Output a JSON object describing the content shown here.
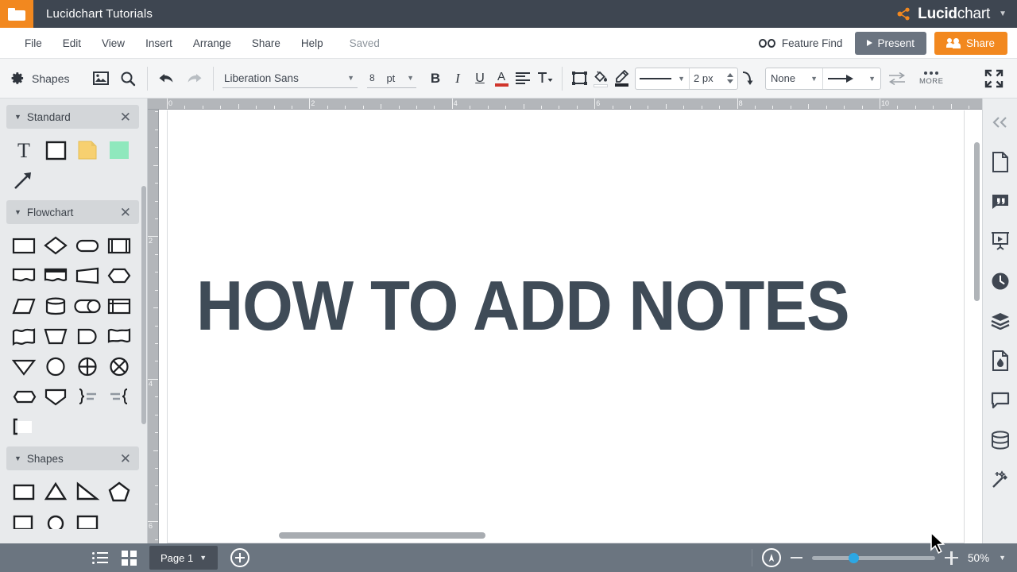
{
  "titlebar": {
    "folder_icon": "folder-icon",
    "document_title": "Lucidchart Tutorials",
    "brand_bold": "Lucid",
    "brand_light": "chart",
    "brand_caret": "▼"
  },
  "menubar": {
    "items": [
      {
        "label": "File"
      },
      {
        "label": "Edit"
      },
      {
        "label": "View"
      },
      {
        "label": "Insert"
      },
      {
        "label": "Arrange"
      },
      {
        "label": "Share"
      },
      {
        "label": "Help"
      }
    ],
    "save_status": "Saved",
    "feature_find": "Feature Find",
    "present_label": "Present",
    "share_label": "Share"
  },
  "toolbar": {
    "shapes_label": "Shapes",
    "image_icon": "image-icon",
    "search_icon": "search-icon",
    "undo_icon": "undo-icon",
    "redo_icon": "redo-icon",
    "font_family": "Liberation Sans",
    "font_size": "8",
    "font_unit": "pt",
    "bold": "B",
    "italic": "I",
    "underline": "U",
    "text_color_letter": "A",
    "text_color": "#d0352b",
    "align_icon": "align-left-icon",
    "text_options_icon": "text-options-icon",
    "shape_border_icon": "shape-border-icon",
    "fill_icon": "fill-bucket-icon",
    "line_color_icon": "line-color-icon",
    "line_style": "solid",
    "line_width": "2 px",
    "curve_icon": "line-curve-icon",
    "arrow_start": "None",
    "arrow_end_icon": "arrow-end-icon",
    "swap_icon": "swap-arrows-icon",
    "more_label": "MORE",
    "fullscreen_icon": "fullscreen-icon",
    "caret": "▼"
  },
  "shape_panel": {
    "sections": [
      {
        "name": "Standard",
        "collapse_icon": "▼",
        "close_icon": "✕",
        "shapes": [
          "text-tool",
          "rectangle",
          "sticky-note",
          "green-block",
          "arrow-tool"
        ]
      },
      {
        "name": "Flowchart",
        "collapse_icon": "▼",
        "close_icon": "✕",
        "shapes": [
          "process",
          "decision",
          "terminator",
          "predefined-process",
          "document",
          "multi-document",
          "trapezoid-data",
          "preparation",
          "parallelogram-data",
          "database-cylinder",
          "direct-access-storage",
          "internal-storage",
          "wave-document",
          "manual-operation",
          "display",
          "delay",
          "merge-triangle",
          "connector-circle",
          "summing-junction",
          "or-junction",
          "stored-data",
          "manual-input",
          "brace-right",
          "brace-left",
          "bracket-card"
        ]
      },
      {
        "name": "Shapes",
        "collapse_icon": "▼",
        "close_icon": "✕",
        "shapes": [
          "square",
          "triangle",
          "right-triangle",
          "pentagon"
        ]
      }
    ]
  },
  "canvas": {
    "title_text": "HOW TO ADD NOTES",
    "title_color": "#3f4b57",
    "ruler_h_labels": [
      "0",
      "2",
      "4",
      "6",
      "8",
      "10"
    ],
    "ruler_v_labels": [
      "2",
      "4",
      "6"
    ],
    "cursor": "mouse-pointer"
  },
  "right_rail": {
    "items": [
      {
        "icon": "collapse-panel-icon",
        "label": "«"
      },
      {
        "icon": "page-document-icon"
      },
      {
        "icon": "notes-quote-icon"
      },
      {
        "icon": "presentation-icon"
      },
      {
        "icon": "revision-history-clock-icon"
      },
      {
        "icon": "layers-icon"
      },
      {
        "icon": "theme-droplet-icon"
      },
      {
        "icon": "comment-bubble-icon"
      },
      {
        "icon": "data-database-icon"
      },
      {
        "icon": "magic-wand-icon"
      }
    ]
  },
  "bottombar": {
    "list_view_icon": "list-view-icon",
    "grid_view_icon": "grid-view-icon",
    "page_tab_label": "Page 1",
    "page_tab_caret": "▼",
    "add_page_icon": "add-page-icon",
    "navigator_icon": "navigator-icon",
    "zoom_out_icon": "zoom-out-icon",
    "zoom_in_icon": "zoom-in-icon",
    "zoom_level": "50%",
    "zoom_caret": "▼",
    "accent_color": "#2ca7e4"
  }
}
